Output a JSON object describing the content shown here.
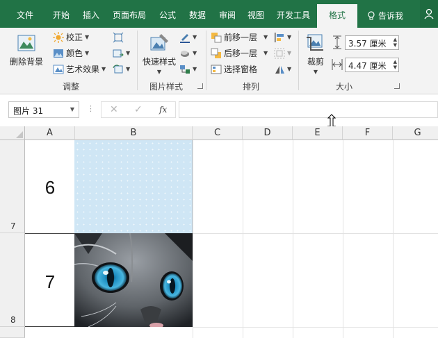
{
  "tabs": [
    "文件",
    "开始",
    "插入",
    "页面布局",
    "公式",
    "数据",
    "审阅",
    "视图",
    "开发工具",
    "格式"
  ],
  "tell_me": "告诉我",
  "ribbon": {
    "remove_bg": "删除背景",
    "correct": "校正",
    "color": "颜色",
    "art_effects": "艺术效果",
    "adjust_group": "调整",
    "quick_styles": "快速样式",
    "pic_styles_group": "图片样式",
    "bring_forward": "前移一层",
    "send_backward": "后移一层",
    "selection_pane": "选择窗格",
    "arrange_group": "排列",
    "crop": "裁剪",
    "height": "3.57 厘米",
    "width": "4.47 厘米",
    "size_group": "大小"
  },
  "formula_bar": {
    "name_box": "图片 31",
    "fx": "fx",
    "cancel": "✕",
    "enter": "✓"
  },
  "columns": [
    "A",
    "B",
    "C",
    "D",
    "E",
    "F",
    "G"
  ],
  "rows": [
    "7",
    "8"
  ],
  "cells": {
    "A7": "6",
    "A8": "7"
  },
  "colors": {
    "excel_green": "#217346",
    "picture_blue": "#cfe6f5"
  }
}
